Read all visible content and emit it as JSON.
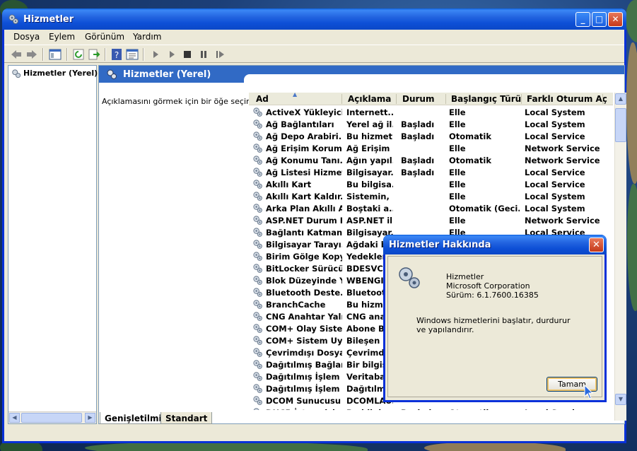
{
  "window": {
    "title": "Hizmetler",
    "min": "_",
    "max": "□",
    "close": "✕"
  },
  "menu": [
    "Dosya",
    "Eylem",
    "Görünüm",
    "Yardım"
  ],
  "tree": {
    "root_label": "Hizmetler (Yerel)"
  },
  "pane": {
    "header": "Hizmetler (Yerel)",
    "description_hint": "Açıklamasını görmek için bir öğe seçin."
  },
  "columns": [
    "Ad",
    "Açıklama",
    "Durum",
    "Başlangıç Türü",
    "Farklı Oturum Aç"
  ],
  "services": [
    {
      "name": "ActiveX Yükleyici...",
      "desc": "Internett...",
      "status": "",
      "start": "Elle",
      "logon": "Local System"
    },
    {
      "name": "Ağ Bağlantıları",
      "desc": "Yerel ağ il...",
      "status": "Başladı",
      "start": "Elle",
      "logon": "Local System"
    },
    {
      "name": "Ağ Depo Arabiri...",
      "desc": "Bu hizmet...",
      "status": "Başladı",
      "start": "Otomatik",
      "logon": "Local Service"
    },
    {
      "name": "Ağ Erişim Korum...",
      "desc": "Ağ Erişim ...",
      "status": "",
      "start": "Elle",
      "logon": "Network Service"
    },
    {
      "name": "Ağ Konumu Tanı...",
      "desc": "Ağın yapıl...",
      "status": "Başladı",
      "start": "Otomatik",
      "logon": "Network Service"
    },
    {
      "name": "Ağ Listesi Hizmeti",
      "desc": "Bilgisayar...",
      "status": "Başladı",
      "start": "Elle",
      "logon": "Local Service"
    },
    {
      "name": "Akıllı Kart",
      "desc": "Bu bilgisa...",
      "status": "",
      "start": "Elle",
      "logon": "Local Service"
    },
    {
      "name": "Akıllı Kart Kaldır...",
      "desc": "Sistemin, ...",
      "status": "",
      "start": "Elle",
      "logon": "Local System"
    },
    {
      "name": "Arka Plan Akıllı A...",
      "desc": "Boştaki a...",
      "status": "",
      "start": "Otomatik (Geci...",
      "logon": "Local System"
    },
    {
      "name": "ASP.NET Durum H...",
      "desc": "ASP.NET il...",
      "status": "",
      "start": "Elle",
      "logon": "Network Service"
    },
    {
      "name": "Bağlantı Katmanı...",
      "desc": "Bilgisayar...",
      "status": "",
      "start": "Elle",
      "logon": "Local Service"
    },
    {
      "name": "Bilgisayar Tarayı...",
      "desc": "Ağdaki bi...",
      "status": "",
      "start": "",
      "logon": ""
    },
    {
      "name": "Birim Gölge Kopy...",
      "desc": "Yedeklem...",
      "status": "",
      "start": "",
      "logon": ""
    },
    {
      "name": "BitLocker Sürücü...",
      "desc": "BDESVC, B...",
      "status": "",
      "start": "",
      "logon": ""
    },
    {
      "name": "Blok Düzeyinde Y...",
      "desc": "WBENGIN...",
      "status": "",
      "start": "",
      "logon": ""
    },
    {
      "name": "Bluetooth Deste...",
      "desc": "Bluetooth...",
      "status": "",
      "start": "",
      "logon": ""
    },
    {
      "name": "BranchCache",
      "desc": "Bu hizmet...",
      "status": "",
      "start": "",
      "logon": ""
    },
    {
      "name": "CNG Anahtar Yalı...",
      "desc": "CNG anah...",
      "status": "",
      "start": "",
      "logon": ""
    },
    {
      "name": "COM+ Olay Siste...",
      "desc": "Abone Bil...",
      "status": "",
      "start": "",
      "logon": ""
    },
    {
      "name": "COM+ Sistem Uy...",
      "desc": "Bileşen N...",
      "status": "",
      "start": "",
      "logon": ""
    },
    {
      "name": "Çevrimdışı Dosya...",
      "desc": "Çevrimdış...",
      "status": "",
      "start": "",
      "logon": ""
    },
    {
      "name": "Dağıtılmış Bağlan...",
      "desc": "Bir bilgisa...",
      "status": "",
      "start": "",
      "logon": ""
    },
    {
      "name": "Dağıtılmış İşlem ...",
      "desc": "Veritaban...",
      "status": "",
      "start": "",
      "logon": ""
    },
    {
      "name": "Dağıtılmış İşlem ...",
      "desc": "Dağıtılmış...",
      "status": "",
      "start": "",
      "logon": ""
    },
    {
      "name": "DCOM Sunucusu ...",
      "desc": "DCOMLAU...",
      "status": "",
      "start": "",
      "logon": ""
    },
    {
      "name": "DHCP İstemcisi",
      "desc": "Bu bilgisa...",
      "status": "Başladı",
      "start": "Otomatik",
      "logon": "Local Service"
    }
  ],
  "tabs": [
    "Genişletilmiş",
    "Standart"
  ],
  "about": {
    "title": "Hizmetler Hakkında",
    "product": "Hizmetler",
    "company": "Microsoft Corporation",
    "version": "Sürüm: 6.1.7600.16385",
    "message": "Windows hizmetlerini başlatır, durdurur ve yapılandırır.",
    "ok": "Tamam",
    "close": "✕"
  }
}
